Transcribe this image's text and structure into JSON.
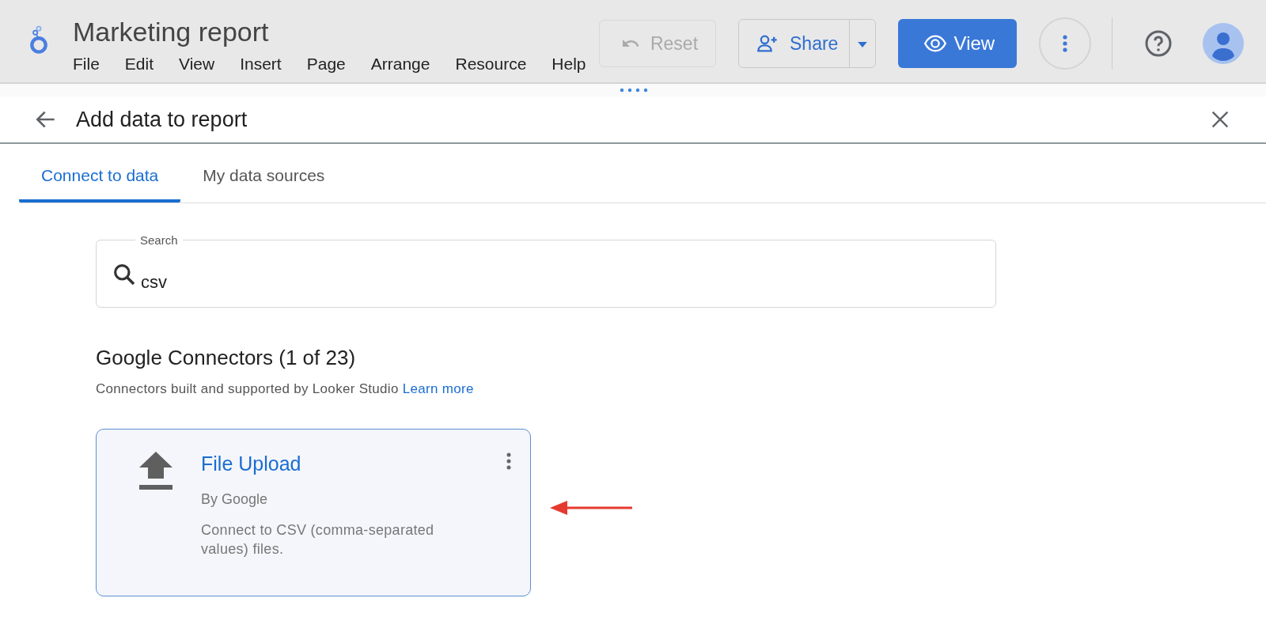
{
  "app_bar": {
    "title": "Marketing report",
    "menu": [
      "File",
      "Edit",
      "View",
      "Insert",
      "Page",
      "Arrange",
      "Resource",
      "Help"
    ],
    "reset_button": {
      "label": "Reset",
      "disabled": true
    },
    "share_button": {
      "label": "Share"
    },
    "view_button": {
      "label": "View"
    }
  },
  "panel": {
    "title": "Add data to report",
    "tabs": [
      {
        "label": "Connect to data",
        "selected": true
      },
      {
        "label": "My data sources",
        "selected": false
      }
    ],
    "search": {
      "label": "Search",
      "value": "csv"
    },
    "section": {
      "heading": "Google Connectors (1 of 23)",
      "description": "Connectors built and supported by Looker Studio",
      "link": "Learn more"
    },
    "connectors": [
      {
        "name": "File Upload",
        "author": "By Google",
        "description": "Connect to CSV (comma-separated values) files."
      }
    ]
  }
}
